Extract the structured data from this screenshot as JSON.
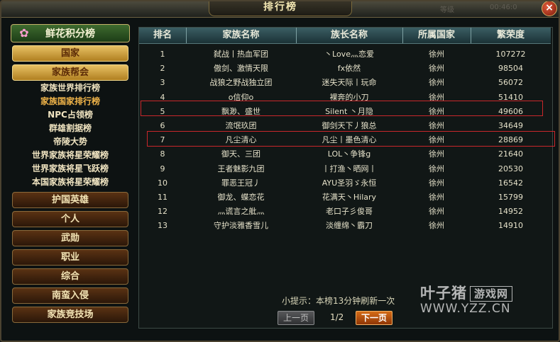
{
  "window": {
    "title": "排行榜",
    "faded_left": "等级",
    "faded_right": "00:46:0"
  },
  "sidebar": {
    "header": "鲜花积分榜",
    "country_label": "国家",
    "family_label": "家族帮会",
    "sub_items": [
      "家族世界排行榜",
      "家族国家排行榜",
      "NPC占领榜",
      "群雄割据榜",
      "帝陵大势",
      "世界家族将星荣耀榜",
      "世界家族将星飞跃榜",
      "本国家族将星荣耀榜"
    ],
    "bottom_items": [
      "护国英雄",
      "个人",
      "武勋",
      "职业",
      "综合",
      "南蛮入侵",
      "家族竞技场"
    ]
  },
  "table": {
    "headers": [
      "排名",
      "家族名称",
      "族长名称",
      "所属国家",
      "繁荣度"
    ],
    "rows": [
      {
        "rank": "1",
        "family": "弑战丨热血军团",
        "leader": "丶Love灬恋爱",
        "country": "徐州",
        "score": "107272"
      },
      {
        "rank": "2",
        "family": "傲剑、激情天限",
        "leader": "fx依然",
        "country": "徐州",
        "score": "98504"
      },
      {
        "rank": "3",
        "family": "战狼之野战独立团",
        "leader": "迷失天际丨玩命",
        "country": "徐州",
        "score": "56072"
      },
      {
        "rank": "4",
        "family": "o信仰o",
        "leader": "裸奔的小刀",
        "country": "徐州",
        "score": "51410"
      },
      {
        "rank": "5",
        "family": "飘渺、盛世",
        "leader": "Silent 丶月隐",
        "country": "徐州",
        "score": "49606"
      },
      {
        "rank": "6",
        "family": "流氓玖团",
        "leader": "御剑天下丿狼总",
        "country": "徐州",
        "score": "34649"
      },
      {
        "rank": "7",
        "family": "凡尘清心",
        "leader": "凡尘丨墨色清心",
        "country": "徐州",
        "score": "28869"
      },
      {
        "rank": "8",
        "family": "御天、三团",
        "leader": "LOL丶争锋g",
        "country": "徐州",
        "score": "21640"
      },
      {
        "rank": "9",
        "family": "王者魅影九团",
        "leader": "丨打渔丶晒网丨",
        "country": "徐州",
        "score": "20530"
      },
      {
        "rank": "10",
        "family": "罪恶王冠丿",
        "leader": "AYU圣羽ゞ永恒",
        "country": "徐州",
        "score": "16542"
      },
      {
        "rank": "11",
        "family": "御龙、蝶恋花",
        "leader": "花满天丶Hilary",
        "country": "徐州",
        "score": "15799"
      },
      {
        "rank": "12",
        "family": "灬谎言之舭灬",
        "leader": "老口子彡俊哥",
        "country": "徐州",
        "score": "14952"
      },
      {
        "rank": "13",
        "family": "守护淡雅香雪儿",
        "leader": "淡缠绵丶霸刀",
        "country": "徐州",
        "score": "14910"
      }
    ]
  },
  "footer": {
    "tip": "小提示：本榜13分钟刷新一次",
    "prev_label": "上一页",
    "page_indicator": "1/2",
    "next_label": "下一页"
  },
  "watermark": {
    "brand": "叶子猪",
    "tag": "游戏网",
    "url": "WWW.YZZ.CN"
  }
}
